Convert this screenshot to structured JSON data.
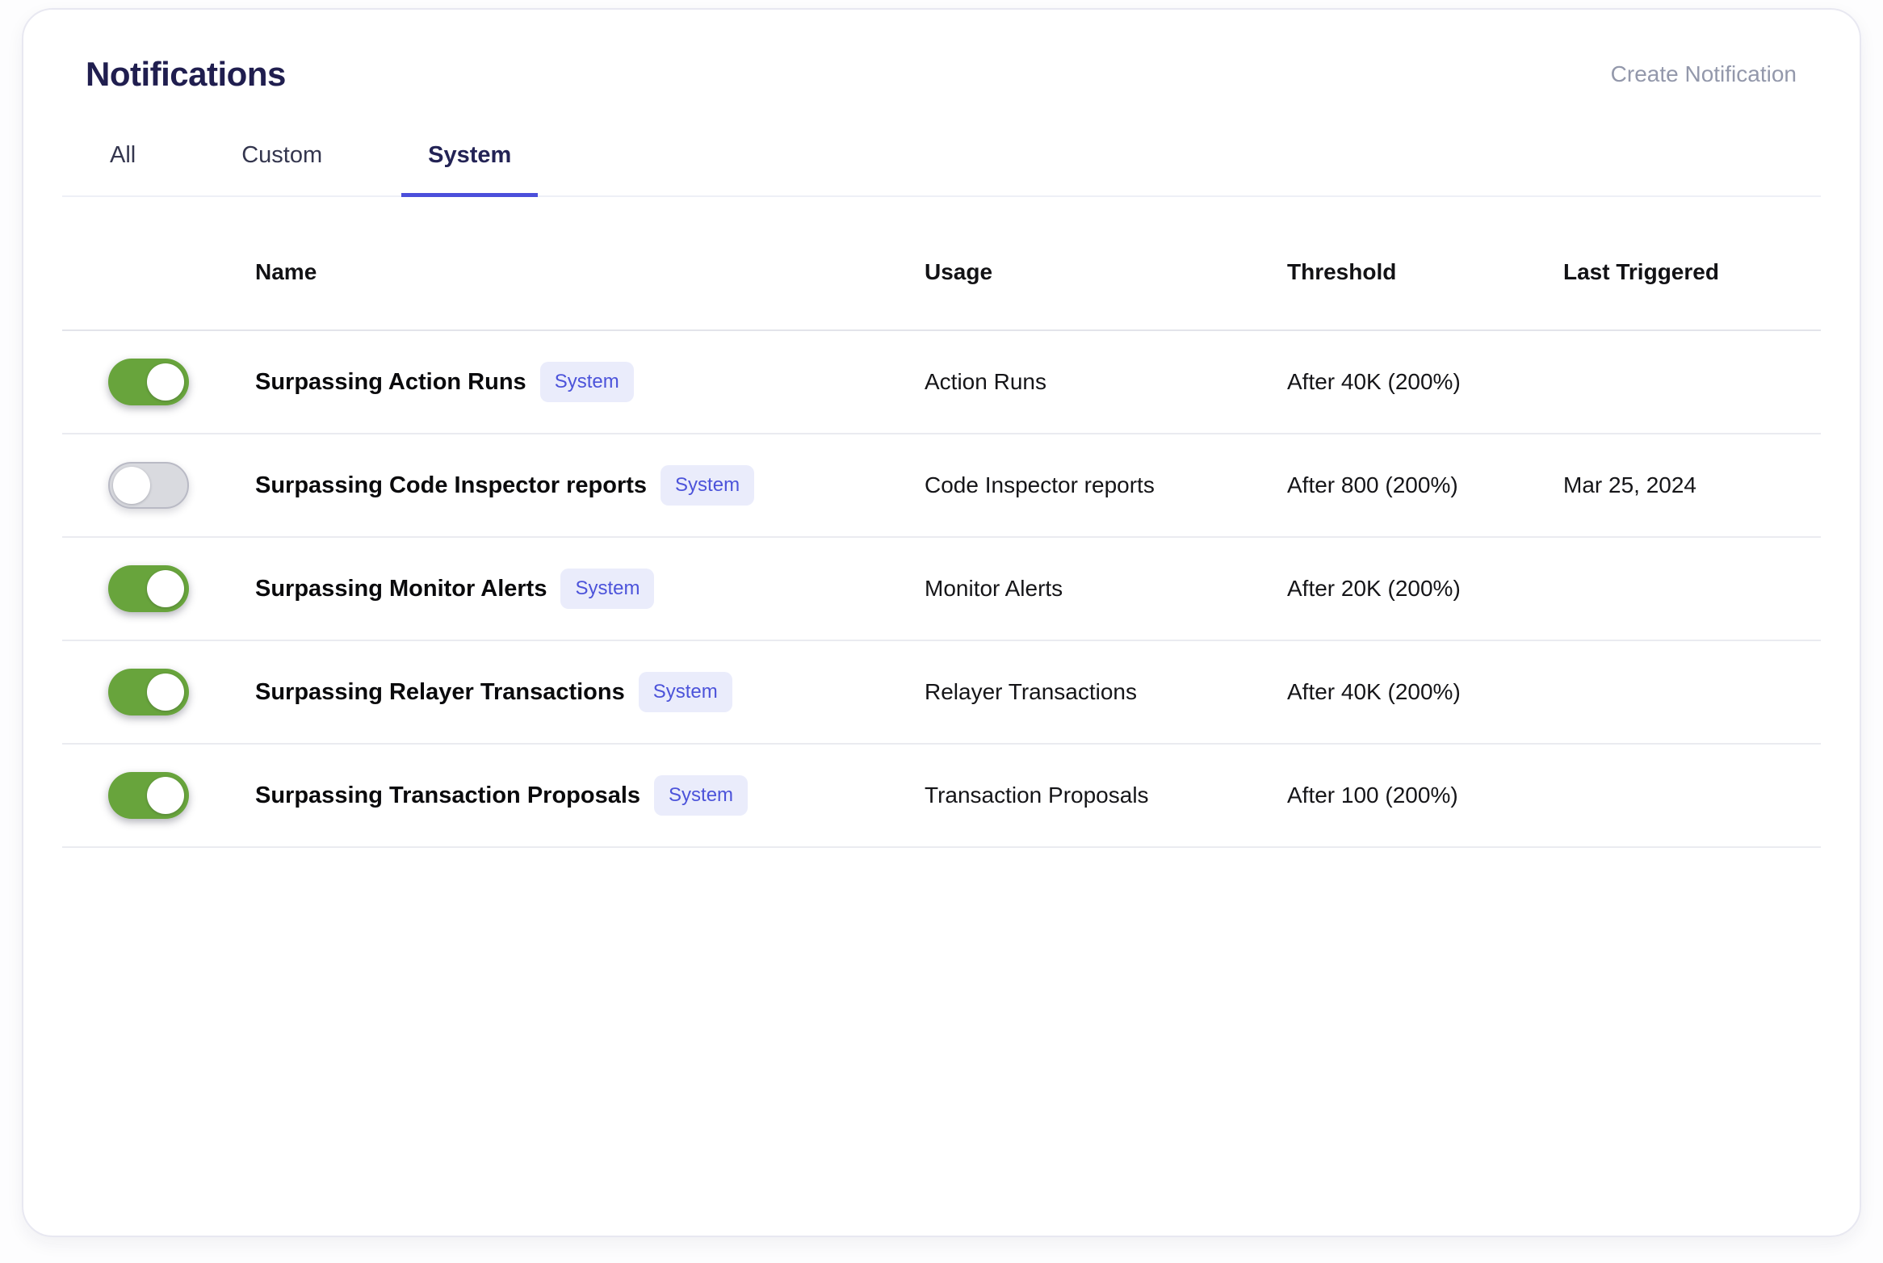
{
  "header": {
    "title": "Notifications",
    "create_button_label": "Create Notification"
  },
  "tabs": [
    {
      "label": "All",
      "active": false
    },
    {
      "label": "Custom",
      "active": false
    },
    {
      "label": "System",
      "active": true
    }
  ],
  "table": {
    "headers": [
      "Name",
      "Usage",
      "Threshold",
      "Last Triggered"
    ],
    "rows": [
      {
        "enabled": true,
        "name": "Surpassing Action Runs",
        "badge": "System",
        "usage": "Action Runs",
        "threshold": "After 40K (200%)",
        "last_triggered": ""
      },
      {
        "enabled": false,
        "name": "Surpassing Code Inspector reports",
        "badge": "System",
        "usage": "Code Inspector reports",
        "threshold": "After 800 (200%)",
        "last_triggered": "Mar 25, 2024"
      },
      {
        "enabled": true,
        "name": "Surpassing Monitor Alerts",
        "badge": "System",
        "usage": "Monitor Alerts",
        "threshold": "After 20K (200%)",
        "last_triggered": ""
      },
      {
        "enabled": true,
        "name": "Surpassing Relayer Transactions",
        "badge": "System",
        "usage": "Relayer Transactions",
        "threshold": "After 40K (200%)",
        "last_triggered": ""
      },
      {
        "enabled": true,
        "name": "Surpassing Transaction Proposals",
        "badge": "System",
        "usage": "Transaction Proposals",
        "threshold": "After 100 (200%)",
        "last_triggered": ""
      }
    ]
  },
  "colors": {
    "toggle_on": "#68a43c",
    "toggle_off": "#d9dadf",
    "badge_bg": "#eaecfb",
    "badge_text": "#4c53da",
    "tab_underline": "#4b4fdb",
    "title_text": "#201e4f"
  }
}
